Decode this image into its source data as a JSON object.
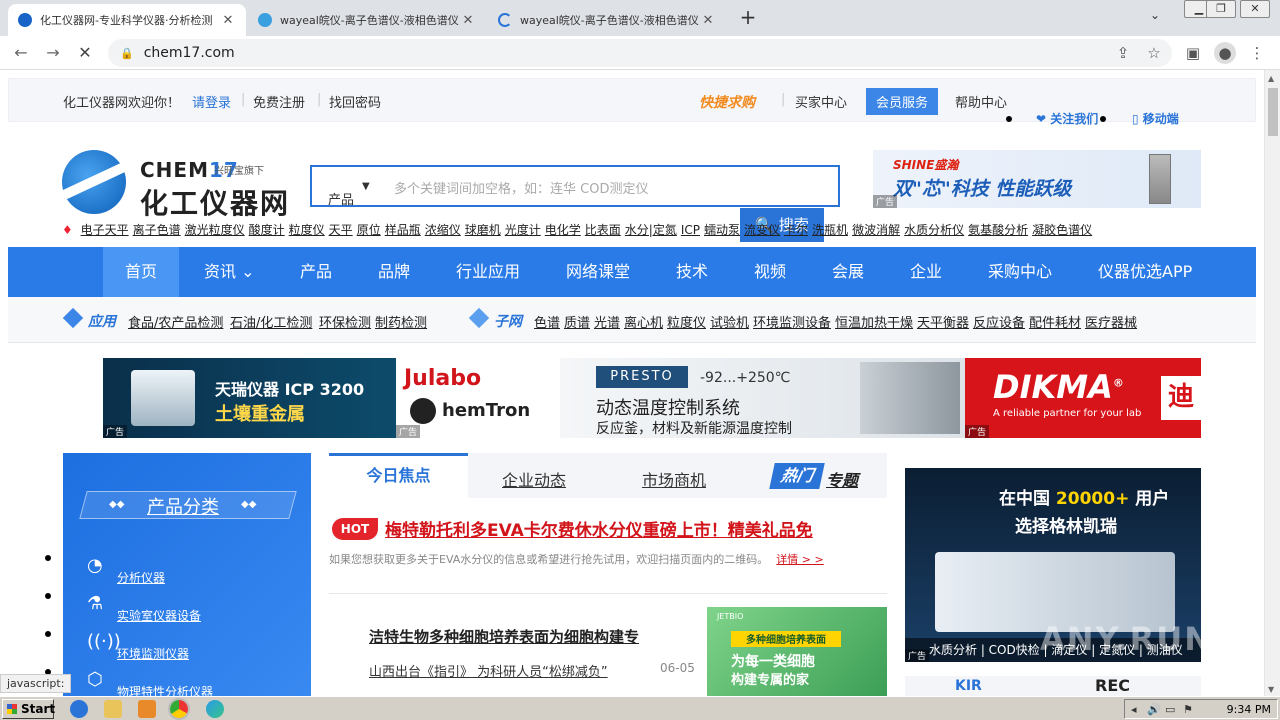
{
  "browser": {
    "tabs": [
      {
        "title": "化工仪器网-专业科学仪器·分析检测",
        "active": true
      },
      {
        "title": "wayeal皖仪-离子色谱仪-液相色谱仪",
        "active": false
      },
      {
        "title": "wayeal皖仪-离子色谱仪-液相色谱仪",
        "active": false
      }
    ],
    "new_tab": "+",
    "address": "chem17.com",
    "status": "javascript:"
  },
  "topbar": {
    "welcome": "化工仪器网欢迎你！",
    "login": "请登录",
    "register": "免费注册",
    "find_password": "找回密码",
    "quick_buy": "快捷求购",
    "buyer_center": "买家中心",
    "member_service": "会员服务",
    "help_center": "帮助中心",
    "follow": "关注我们",
    "mobile": "移动端"
  },
  "logo": {
    "en_a": "CHEM",
    "en_b": "17",
    "sub": "兴旺宝旗下",
    "cn": "化工仪器网"
  },
  "search": {
    "category": "产品",
    "placeholder": "多个关键词间加空格，如：连华 COD测定仪",
    "button": "搜索"
  },
  "hotwords": [
    "电子天平",
    "离子色谱",
    "激光粒度仪",
    "酸度计",
    "粒度仪",
    "天平",
    "原位",
    "样品瓶",
    "浓缩仪",
    "球磨机",
    "光度计",
    "电化学",
    "比表面",
    "水分|定氮",
    "ICP",
    "蠕动泵",
    "流变仪",
    "卡尔",
    "洗瓶机",
    "微波消解",
    "水质分析仪",
    "氨基酸分析",
    "凝胶色谱仪"
  ],
  "shine_ad": {
    "brand": "SHINE盛瀚",
    "slogan": "双\"芯\"科技 性能跃级",
    "tag": "广告"
  },
  "main_nav": [
    "首页",
    "资讯",
    "产品",
    "品牌",
    "行业应用",
    "网络课堂",
    "技术",
    "视频",
    "会展",
    "企业",
    "采购中心",
    "仪器优选APP"
  ],
  "sub_nav": {
    "app_label": "应用",
    "app_links": [
      "食品/农产品检测",
      "石油/化工检测",
      "环保检测",
      "制药检测"
    ],
    "sub_label": "子网",
    "sub_links": [
      "色谱",
      "质谱",
      "光谱",
      "离心机",
      "粒度仪",
      "试验机",
      "环境监测设备",
      "恒温加热干燥",
      "天平衡器",
      "反应设备",
      "配件耗材",
      "医疗器械"
    ]
  },
  "banners": {
    "b1": {
      "l1": "天瑞仪器 ICP 3200",
      "l2": "土壤重金属",
      "tag": "广告"
    },
    "b2": {
      "l1": "Julabo",
      "l2": "hemTron",
      "tag": "广告"
    },
    "b3": {
      "brand": "PRESTO",
      "temp": "-92...+250℃",
      "l1": "动态温度控制系统",
      "l2": "反应釜，材料及新能源温度控制"
    },
    "b4": {
      "brand": "DIKMA",
      "reg": "®",
      "slogan": "A reliable partner for your lab",
      "side": "迪",
      "tag": "广告"
    }
  },
  "categories": {
    "title": "产品分类",
    "items": [
      {
        "icon": "pie-chart-icon",
        "label": "分析仪器"
      },
      {
        "icon": "flask-icon",
        "label": "实验室仪器设备"
      },
      {
        "icon": "signal-icon",
        "label": "环境监测仪器"
      },
      {
        "icon": "cube-icon",
        "label": "物理特性分析仪器"
      }
    ]
  },
  "news": {
    "tabs": [
      "今日焦点",
      "企业动态",
      "市场商机"
    ],
    "hot_a": "热门",
    "hot_b": "专题",
    "hot_badge": "HOT",
    "headline": "梅特勒托利多EVA卡尔费休水分仪重磅上市！精美礼品免",
    "desc": "如果您想获取更多关于EVA水分仪的信息或希望进行抢先试用，欢迎扫描页面内的二维码。",
    "more": "详情 > >",
    "item2": "洁特生物多种细胞培养表面为细胞构建专",
    "item3": "山西出台《指引》 为科研人员“松绑减负”",
    "item3_date": "06-05",
    "thumb_tag": "多种细胞培养表面",
    "thumb_title": "为每一类细胞",
    "thumb_sub": "构建专属的家",
    "thumb_brand": "JETBIO"
  },
  "right_ad": {
    "l1_a": "在中国",
    "l1_num": "20000+",
    "l1_b": "用户",
    "l2": "选择格林凯瑞",
    "foot": "水质分析 | COD快检 | 滴定仪 | 定氮仪 | 测油仪",
    "tag": "广告",
    "ad2_a": "KIR",
    "ad2_b": "REC"
  },
  "watermark": "ANY.RUN",
  "taskbar": {
    "start": "Start",
    "time": "9:34 PM"
  }
}
